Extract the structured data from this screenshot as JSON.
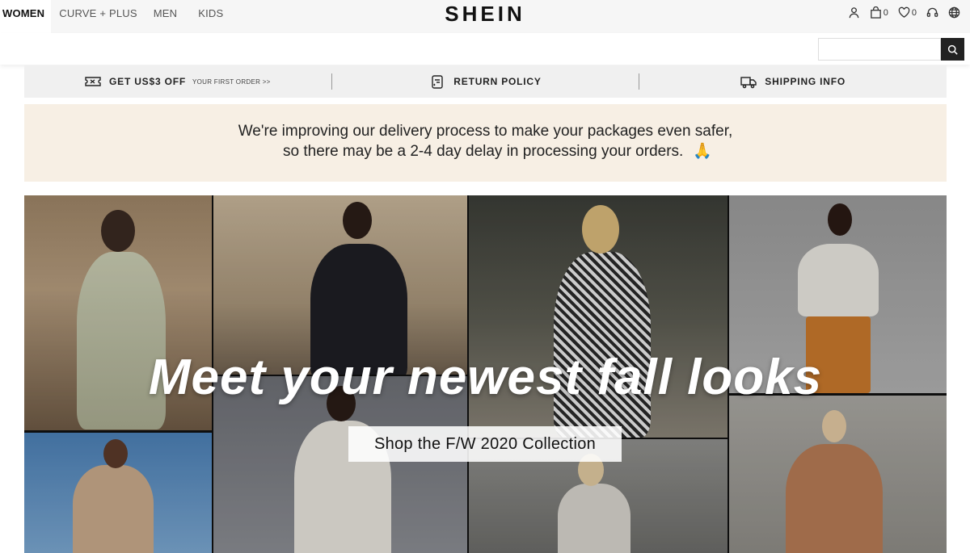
{
  "nav": {
    "items": [
      {
        "label": "WOMEN",
        "active": true
      },
      {
        "label": "CURVE + PLUS",
        "active": false
      },
      {
        "label": "MEN",
        "active": false
      },
      {
        "label": "KIDS",
        "active": false
      }
    ]
  },
  "brand": {
    "logo": "SHEIN"
  },
  "header_icons": [
    {
      "icon": "user-icon"
    },
    {
      "icon": "bag-icon",
      "count": "0"
    },
    {
      "icon": "heart-icon",
      "count": "0"
    },
    {
      "icon": "headset-icon"
    },
    {
      "icon": "globe-icon"
    }
  ],
  "search": {
    "placeholder": "",
    "value": "",
    "icon": "search-icon"
  },
  "promo": {
    "offer": {
      "title": "GET US$3 OFF",
      "subtitle": "YOUR FIRST ORDER >>",
      "icon": "ticket-icon"
    },
    "returns": {
      "title": "RETURN POLICY",
      "icon": "return-box-icon"
    },
    "shipping": {
      "title": "SHIPPING INFO",
      "icon": "truck-icon"
    }
  },
  "notice": {
    "line1": "We're improving our delivery process to make your packages even safer,",
    "line2": "so there may be a 2-4 day delay in processing your orders.",
    "emoji": "🙏"
  },
  "hero": {
    "title": "Meet your newest fall looks",
    "cta": "Shop the F/W 2020 Collection"
  },
  "colors": {
    "header_bg": "#f6f6f6",
    "promo_bg": "#f0f0f0",
    "notice_bg": "#f7efe4",
    "search_button": "#222222"
  }
}
